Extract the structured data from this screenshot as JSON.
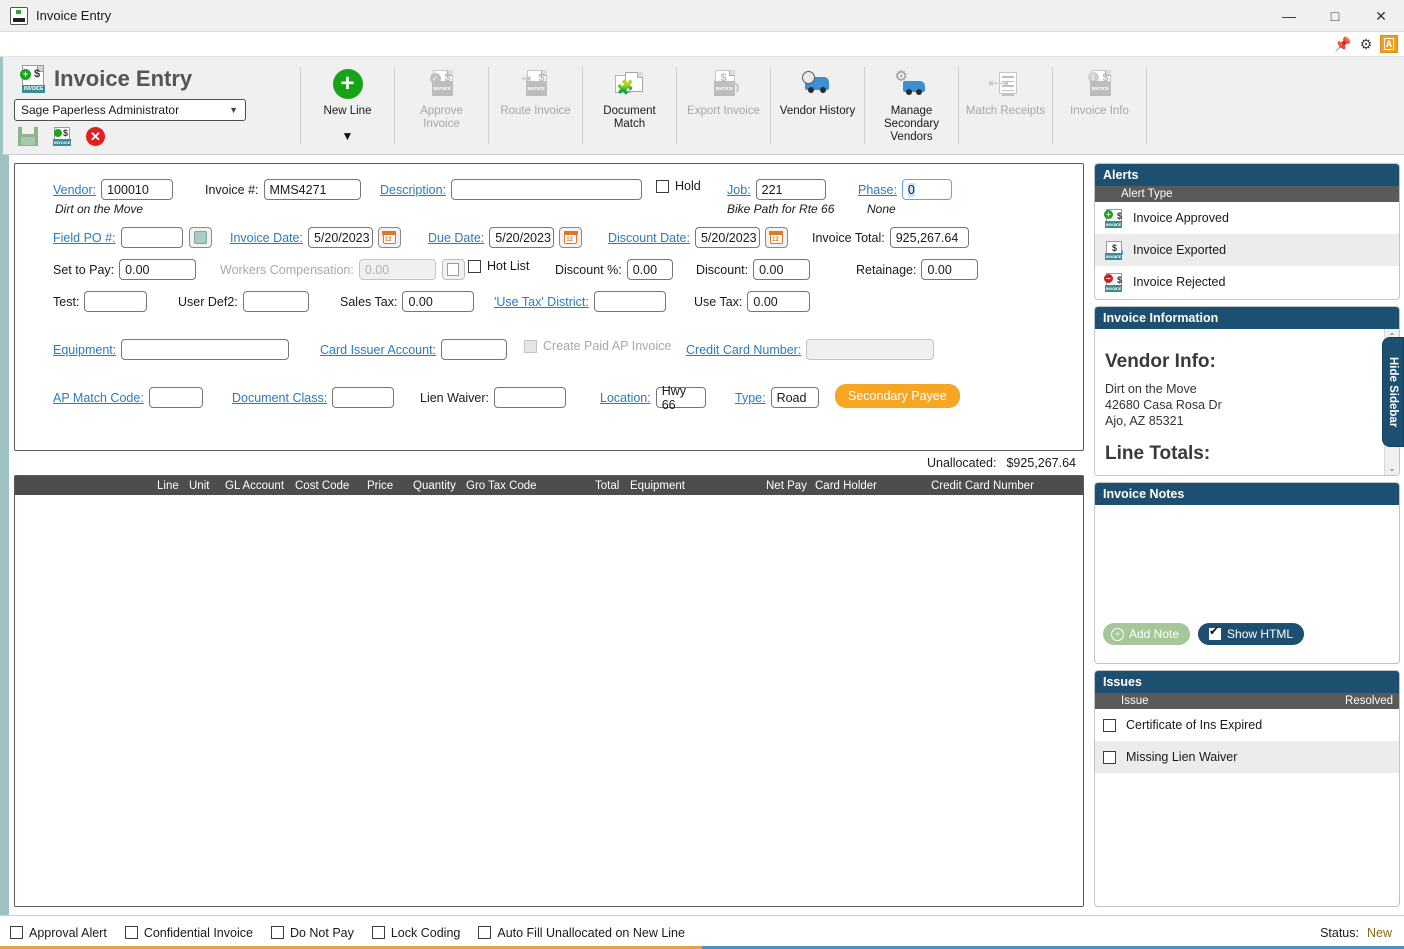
{
  "window": {
    "title": "Invoice Entry",
    "app_icon": "invoice-app-icon",
    "minimize": "—",
    "maximize": "□",
    "close": "✕"
  },
  "subbar": {
    "pin_icon": "pin-icon",
    "gear_icon": "gear-icon",
    "badge_label": "A"
  },
  "ribbon": {
    "brand_title": "Invoice Entry",
    "user_select": {
      "value": "Sage Paperless Administrator",
      "caret": "▼"
    },
    "quick_icons": [
      {
        "name": "save-icon",
        "label": "Save"
      },
      {
        "name": "save-invoice-icon",
        "label": "Save Invoice"
      },
      {
        "name": "delete-icon",
        "label": "Delete"
      }
    ],
    "buttons": [
      {
        "name": "new-line",
        "label": "New Line",
        "enabled": true,
        "has_caret": true,
        "caret": "▼"
      },
      {
        "name": "approve-invoice",
        "label": "Approve\nInvoice",
        "label1": "Approve",
        "label2": "Invoice",
        "enabled": false
      },
      {
        "name": "route-invoice",
        "label": "Route Invoice",
        "label1": "Route Invoice",
        "label2": "",
        "enabled": false
      },
      {
        "name": "document-match",
        "label": "Document Match",
        "label1": "Document",
        "label2": "Match",
        "enabled": true
      },
      {
        "name": "export-invoice",
        "label": "Export Invoice",
        "label1": "Export Invoice",
        "label2": "",
        "enabled": false
      },
      {
        "name": "vendor-history",
        "label": "Vendor History",
        "label1": "Vendor History",
        "label2": "",
        "enabled": true
      },
      {
        "name": "manage-secondary-vendors",
        "label": "Manage Secondary Vendors",
        "label1": "Manage",
        "label2": "Secondary",
        "label3": "Vendors",
        "enabled": true
      },
      {
        "name": "match-receipts",
        "label": "Match Receipts",
        "label1": "Match Receipts",
        "label2": "",
        "enabled": false
      },
      {
        "name": "invoice-info",
        "label": "Invoice Info",
        "label1": "Invoice Info",
        "label2": "",
        "enabled": false
      }
    ]
  },
  "form": {
    "vendor_label": "Vendor:",
    "vendor_value": "100010",
    "vendor_name": "Dirt on the Move",
    "invoice_num_label": "Invoice #:",
    "invoice_num_value": "MMS4271",
    "description_label": "Description:",
    "description_value": "",
    "hold_label": "Hold",
    "hold_checked": false,
    "job_label": "Job:",
    "job_value": "221",
    "job_name": "Bike Path for Rte 66",
    "phase_label": "Phase:",
    "phase_value": "0",
    "phase_name": "None",
    "field_po_label": "Field PO #:",
    "field_po_value": "",
    "invoice_date_label": "Invoice Date:",
    "invoice_date_value": "5/20/2023",
    "due_date_label": "Due Date:",
    "due_date_value": "5/20/2023",
    "discount_date_label": "Discount Date:",
    "discount_date_value": "5/20/2023",
    "invoice_total_label": "Invoice Total:",
    "invoice_total_value": "925,267.64",
    "set_to_pay_label": "Set to Pay:",
    "set_to_pay_value": "0.00",
    "workers_comp_label": "Workers Compensation:",
    "workers_comp_value": "0.00",
    "hot_list_label": "Hot List",
    "hot_list_checked": false,
    "discount_pct_label": "Discount %:",
    "discount_pct_value": "0.00",
    "discount_label": "Discount:",
    "discount_value": "0.00",
    "retainage_label": "Retainage:",
    "retainage_value": "0.00",
    "test_label": "Test:",
    "test_value": "",
    "user_def2_label": "User Def2:",
    "user_def2_value": "",
    "sales_tax_label": "Sales Tax:",
    "sales_tax_value": "0.00",
    "use_tax_district_label": "'Use Tax' District:",
    "use_tax_district_value": "",
    "use_tax_label": "Use Tax:",
    "use_tax_value": "0.00",
    "equipment_label": "Equipment:",
    "equipment_value": "",
    "card_issuer_label": "Card Issuer Account:",
    "card_issuer_value": "",
    "create_paid_ap_label": "Create Paid AP Invoice",
    "create_paid_ap_checked": false,
    "credit_card_number_label": "Credit Card Number:",
    "credit_card_number_value": "",
    "ap_match_code_label": "AP Match Code:",
    "ap_match_code_value": "",
    "document_class_label": "Document Class:",
    "document_class_value": "",
    "lien_waiver_label": "Lien Waiver:",
    "lien_waiver_value": "",
    "location_label": "Location:",
    "location_value": "Hwy 66",
    "type_label": "Type:",
    "type_value": "Road",
    "secondary_payee_label": "Secondary Payee"
  },
  "unallocated": {
    "label": "Unallocated:",
    "value": "$925,267.64"
  },
  "grid": {
    "columns": [
      "Line",
      "Unit",
      "GL Account",
      "Cost Code",
      "Price",
      "Quantity",
      "Gro",
      "Tax Code",
      "Total",
      "Equipment",
      "Net Pay",
      "Card Holder",
      "Credit Card Number"
    ],
    "rows": []
  },
  "sidebar": {
    "hide_label": "Hide Sidebar",
    "alerts": {
      "title": "Alerts",
      "column_header": "Alert Type",
      "items": [
        {
          "label": "Invoice Approved",
          "icon": "invoice-approved-icon"
        },
        {
          "label": "Invoice Exported",
          "icon": "invoice-exported-icon"
        },
        {
          "label": "Invoice Rejected",
          "icon": "invoice-rejected-icon"
        }
      ]
    },
    "invoice_information": {
      "title": "Invoice Information",
      "vendor_heading": "Vendor Info:",
      "vendor_lines": [
        "Dirt on the Move",
        "42680 Casa Rosa Dr",
        "Ajo, AZ 85321"
      ],
      "line_totals_heading": "Line Totals:"
    },
    "invoice_notes": {
      "title": "Invoice Notes",
      "body": "",
      "add_note_label": "Add Note",
      "show_html_label": "Show HTML",
      "show_html_checked": true
    },
    "issues": {
      "title": "Issues",
      "col_issue": "Issue",
      "col_resolved": "Resolved",
      "items": [
        {
          "label": "Certificate of Ins Expired",
          "resolved": false
        },
        {
          "label": "Missing Lien Waiver",
          "resolved": false
        }
      ]
    }
  },
  "statusbar": {
    "checkboxes": [
      {
        "label": "Approval Alert",
        "checked": false
      },
      {
        "label": "Confidential Invoice",
        "checked": false
      },
      {
        "label": "Do Not Pay",
        "checked": false
      },
      {
        "label": "Lock Coding",
        "checked": false
      },
      {
        "label": "Auto Fill Unallocated on New Line",
        "checked": false
      }
    ],
    "status_label": "Status:",
    "status_value": "New"
  },
  "colors": {
    "panel_header": "#1d4f70",
    "accent_orange": "#f5a623",
    "link": "#2a7bbf",
    "grid_header": "#4d4d4d"
  }
}
